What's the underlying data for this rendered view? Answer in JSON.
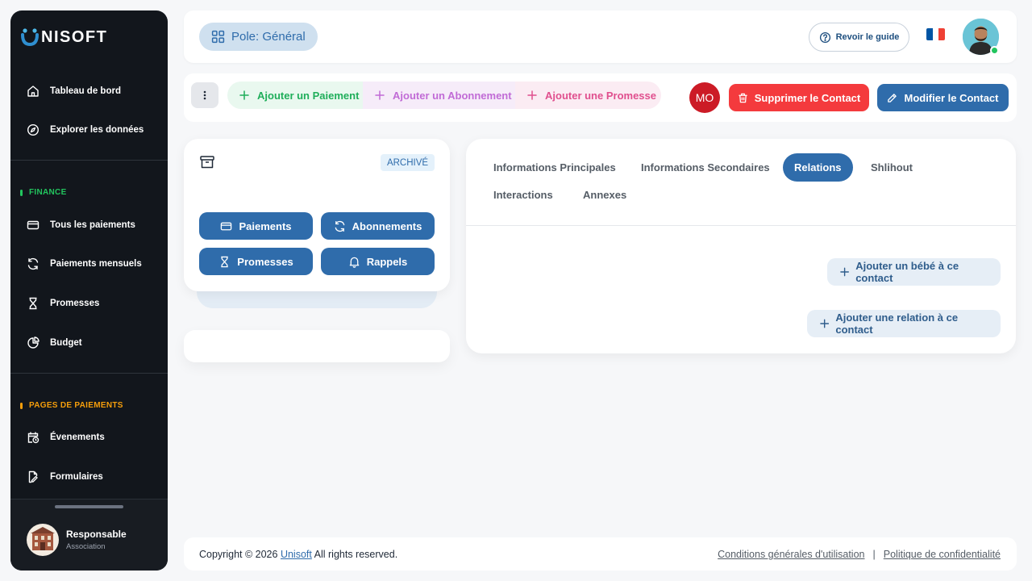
{
  "brand": {
    "name": "NISOFT"
  },
  "sidebar": {
    "items": [
      {
        "label": "Tableau de bord",
        "icon": "home-icon"
      },
      {
        "label": "Explorer les données",
        "icon": "compass-icon"
      }
    ],
    "finance": {
      "title": "FINANCE",
      "color": "#22c55e",
      "items": [
        {
          "label": "Tous les paiements",
          "icon": "credit-card-icon"
        },
        {
          "label": "Paiements mensuels",
          "icon": "refresh-icon"
        },
        {
          "label": "Promesses",
          "icon": "hourglass-icon"
        },
        {
          "label": "Budget",
          "icon": "pie-chart-icon"
        }
      ]
    },
    "payment_pages": {
      "title": "PAGES DE PAIEMENTS",
      "color": "#f59e0b",
      "items": [
        {
          "label": "Évenements",
          "icon": "calendar-clock-icon"
        },
        {
          "label": "Formulaires",
          "icon": "file-edit-icon"
        }
      ]
    },
    "user": {
      "name": "Responsable",
      "role": "Association"
    }
  },
  "header": {
    "pole_label": "Pole: Général",
    "guide_label": "Revoir le guide",
    "language": "FR"
  },
  "actions": {
    "add_payment": "Ajouter un Paiement",
    "add_subscription": "Ajouter un Abonnement",
    "add_promise": "Ajouter une Promesse",
    "initials": "MO",
    "delete_contact": "Supprimer le Contact",
    "edit_contact": "Modifier le Contact"
  },
  "contact_card": {
    "badge": "ARCHIVÉ",
    "buttons": [
      "Paiements",
      "Abonnements",
      "Promesses",
      "Rappels"
    ]
  },
  "tabs": [
    {
      "label": "Informations Principales",
      "active": false
    },
    {
      "label": "Informations Secondaires",
      "active": false
    },
    {
      "label": "Relations",
      "active": true
    },
    {
      "label": "Shlihout",
      "active": false
    },
    {
      "label": "Interactions",
      "active": false
    },
    {
      "label": "Annexes",
      "active": false
    }
  ],
  "relations": {
    "add_baby": "Ajouter un bébé à ce contact",
    "add_relation": "Ajouter une relation à ce contact"
  },
  "footer": {
    "copyright_prefix": "Copyright © 2026",
    "company_link": "Unisoft",
    "copyright_suffix": "All rights reserved.",
    "terms": "Conditions générales d'utilisation",
    "separator": "|",
    "privacy": "Politique de confidentialité"
  },
  "colors": {
    "primary": "#2f6cab",
    "danger": "#f43a3d",
    "sidebar_bg": "#12161c"
  }
}
